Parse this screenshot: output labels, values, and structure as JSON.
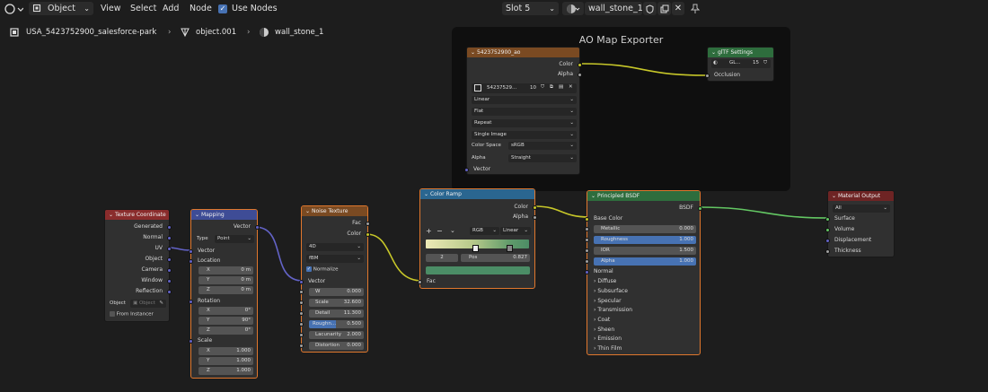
{
  "topbar": {
    "mode": "Object",
    "menu": [
      "View",
      "Select",
      "Add",
      "Node"
    ],
    "use_nodes_label": "Use Nodes",
    "slot": "Slot 5",
    "material": "wall_stone_1"
  },
  "breadcrumb": {
    "scene": "USA_5423752900_salesforce-park",
    "object": "object.001",
    "material": "wall_stone_1"
  },
  "frame": {
    "title": "AO Map Exporter"
  },
  "image_node": {
    "title": "5423752900_ao",
    "out_color": "Color",
    "out_alpha": "Alpha",
    "image_name": "54237529...",
    "users": "10",
    "interpolation": "Linear",
    "projection": "Flat",
    "extension": "Repeat",
    "source": "Single Image",
    "color_space_label": "Color Space",
    "color_space": "sRGB",
    "alpha_label": "Alpha",
    "alpha": "Straight",
    "in_vector": "Vector"
  },
  "gltf_node": {
    "title": "glTF Settings",
    "group_name": "GL...",
    "users": "15",
    "in_occlusion": "Occlusion"
  },
  "texcoord_node": {
    "title": "Texture Coordinate",
    "outputs": [
      "Generated",
      "Normal",
      "UV",
      "Object",
      "Camera",
      "Window",
      "Reflection"
    ],
    "object_label": "Object",
    "object_placeholder": "Object",
    "from_instancer": "From Instancer"
  },
  "mapping_node": {
    "title": "Mapping",
    "out_vector": "Vector",
    "type_label": "Type",
    "type_value": "Point",
    "in_vector": "Vector",
    "location_label": "Location",
    "location": [
      {
        "axis": "X",
        "value": "0 m"
      },
      {
        "axis": "Y",
        "value": "0 m"
      },
      {
        "axis": "Z",
        "value": "0 m"
      }
    ],
    "rotation_label": "Rotation",
    "rotation": [
      {
        "axis": "X",
        "value": "0°"
      },
      {
        "axis": "Y",
        "value": "90°"
      },
      {
        "axis": "Z",
        "value": "0°"
      }
    ],
    "scale_label": "Scale",
    "scale": [
      {
        "axis": "X",
        "value": "1.000"
      },
      {
        "axis": "Y",
        "value": "1.000"
      },
      {
        "axis": "Z",
        "value": "1.000"
      }
    ]
  },
  "noise_node": {
    "title": "Noise Texture",
    "out_fac": "Fac",
    "out_color": "Color",
    "dimensions": "4D",
    "type": "fBM",
    "normalize": "Normalize",
    "in_vector": "Vector",
    "params": [
      {
        "label": "W",
        "value": "0.000"
      },
      {
        "label": "Scale",
        "value": "32.600"
      },
      {
        "label": "Detail",
        "value": "11.300"
      },
      {
        "label": "Roughn...",
        "value": "0.500"
      },
      {
        "label": "Lacunarity",
        "value": "2.000"
      },
      {
        "label": "Distortion",
        "value": "0.000"
      }
    ]
  },
  "ramp_node": {
    "title": "Color Ramp",
    "out_color": "Color",
    "out_alpha": "Alpha",
    "color_mode": "RGB",
    "interpolation": "Linear",
    "stop_index": "2",
    "pos_label": "Pos",
    "pos_value": "0.827",
    "in_fac": "Fac"
  },
  "bsdf_node": {
    "title": "Principled BSDF",
    "out_bsdf": "BSDF",
    "in_base_color": "Base Color",
    "fields": [
      {
        "label": "Metallic",
        "value": "0.000"
      },
      {
        "label": "Roughness",
        "value": "1.000"
      },
      {
        "label": "IOR",
        "value": "1.500"
      },
      {
        "label": "Alpha",
        "value": "1.000"
      }
    ],
    "in_normal": "Normal",
    "panels": [
      "Diffuse",
      "Subsurface",
      "Specular",
      "Transmission",
      "Coat",
      "Sheen",
      "Emission",
      "Thin Film"
    ]
  },
  "output_node": {
    "title": "Material Output",
    "target": "All",
    "inputs": [
      "Surface",
      "Volume",
      "Displacement",
      "Thickness"
    ]
  },
  "colors": {
    "accent_orange": "#e0772d",
    "socket_vector": "#6363c7",
    "socket_color": "#c7c729",
    "socket_float": "#a1a1a1",
    "socket_shader": "#63c763",
    "field_blue": "#4772b3"
  }
}
